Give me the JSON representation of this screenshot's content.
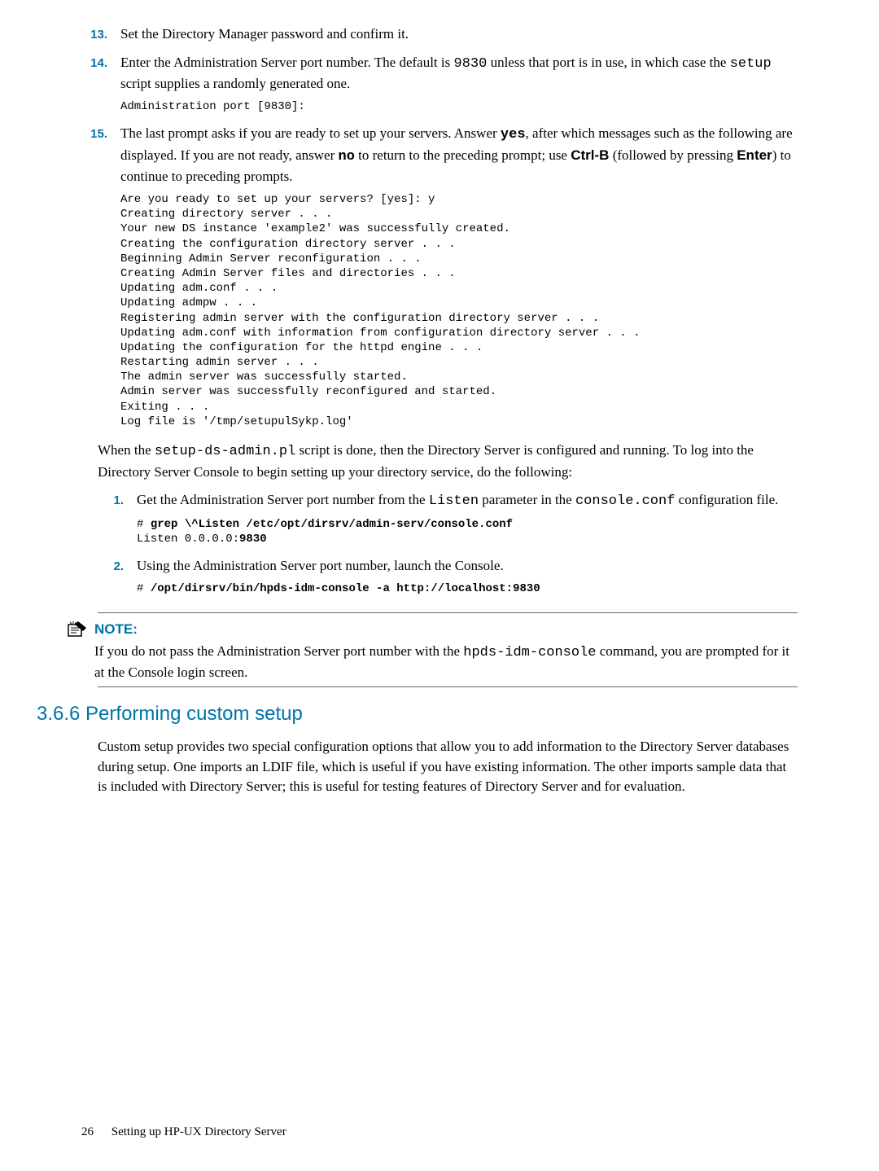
{
  "steps_a": [
    {
      "num": "13.",
      "text_parts": [
        {
          "t": "Set the Directory Manager password and confirm it.",
          "cls": ""
        }
      ],
      "code": ""
    },
    {
      "num": "14.",
      "text_parts": [
        {
          "t": "Enter the Administration Server port number. The default is ",
          "cls": ""
        },
        {
          "t": "9830",
          "cls": "mono"
        },
        {
          "t": " unless that port is in use, in which case the ",
          "cls": ""
        },
        {
          "t": "setup",
          "cls": "mono"
        },
        {
          "t": " script supplies a randomly generated one.",
          "cls": ""
        }
      ],
      "code": "Administration port [9830]:"
    },
    {
      "num": "15.",
      "text_parts": [
        {
          "t": "The last prompt asks if you are ready to set up your servers. Answer ",
          "cls": ""
        },
        {
          "t": "yes",
          "cls": "bold-mono"
        },
        {
          "t": ", after which messages such as the following are displayed. If you are not ready, answer ",
          "cls": ""
        },
        {
          "t": "no",
          "cls": "bold-mono"
        },
        {
          "t": " to return to the preceding prompt; use ",
          "cls": ""
        },
        {
          "t": "Ctrl-B",
          "cls": "bold-sans"
        },
        {
          "t": " (followed by pressing ",
          "cls": ""
        },
        {
          "t": "Enter",
          "cls": "bold-sans"
        },
        {
          "t": ") to continue to preceding prompts.",
          "cls": ""
        }
      ],
      "code": "Are you ready to set up your servers? [yes]: y\nCreating directory server . . .\nYour new DS instance 'example2' was successfully created.\nCreating the configuration directory server . . .\nBeginning Admin Server reconfiguration . . .\nCreating Admin Server files and directories . . .\nUpdating adm.conf . . .\nUpdating admpw . . .\nRegistering admin server with the configuration directory server . . .\nUpdating adm.conf with information from configuration directory server . . .\nUpdating the configuration for the httpd engine . . .\nRestarting admin server . . .\nThe admin server was successfully started.\nAdmin server was successfully reconfigured and started.\nExiting . . .\nLog file is '/tmp/setupulSykp.log'"
    }
  ],
  "para1_parts": [
    {
      "t": "When the ",
      "cls": ""
    },
    {
      "t": "setup-ds-admin.pl",
      "cls": "mono"
    },
    {
      "t": " script is done, then the Directory Server is configured and running. To log into the Directory Server Console to begin setting up your directory service, do the following:",
      "cls": ""
    }
  ],
  "steps_b": [
    {
      "num": "1.",
      "text_parts": [
        {
          "t": "Get the Administration Server port number from the ",
          "cls": ""
        },
        {
          "t": "Listen",
          "cls": "mono"
        },
        {
          "t": " parameter in the ",
          "cls": ""
        },
        {
          "t": "console.conf",
          "cls": "mono"
        },
        {
          "t": " configuration file.",
          "cls": ""
        }
      ],
      "code_parts": [
        {
          "t": "# ",
          "cls": ""
        },
        {
          "t": "grep \\^Listen /etc/opt/dirsrv/admin-serv/console.conf",
          "cls": "bold"
        },
        {
          "t": "\nListen 0.0.0.0:",
          "cls": ""
        },
        {
          "t": "9830",
          "cls": "bold"
        }
      ]
    },
    {
      "num": "2.",
      "text_parts": [
        {
          "t": "Using the Administration Server port number, launch the Console.",
          "cls": ""
        }
      ],
      "code_parts": [
        {
          "t": "# ",
          "cls": ""
        },
        {
          "t": "/opt/dirsrv/bin/hpds-idm-console -a http://localhost:9830",
          "cls": "bold"
        }
      ]
    }
  ],
  "note": {
    "label": "NOTE:",
    "text_parts": [
      {
        "t": "If you do not pass the Administration Server port number with the ",
        "cls": ""
      },
      {
        "t": "hpds-idm-console",
        "cls": "mono"
      },
      {
        "t": " command, you are prompted for it at the Console login screen.",
        "cls": ""
      }
    ]
  },
  "section": {
    "heading": "3.6.6 Performing custom setup",
    "body": "Custom setup provides two special configuration options that allow you to add information to the Directory Server databases during setup. One imports an LDIF file, which is useful if you have existing information. The other imports sample data that is included with Directory Server; this is useful for testing features of Directory Server and for evaluation."
  },
  "footer": {
    "page": "26",
    "title": "Setting up HP-UX Directory Server"
  }
}
